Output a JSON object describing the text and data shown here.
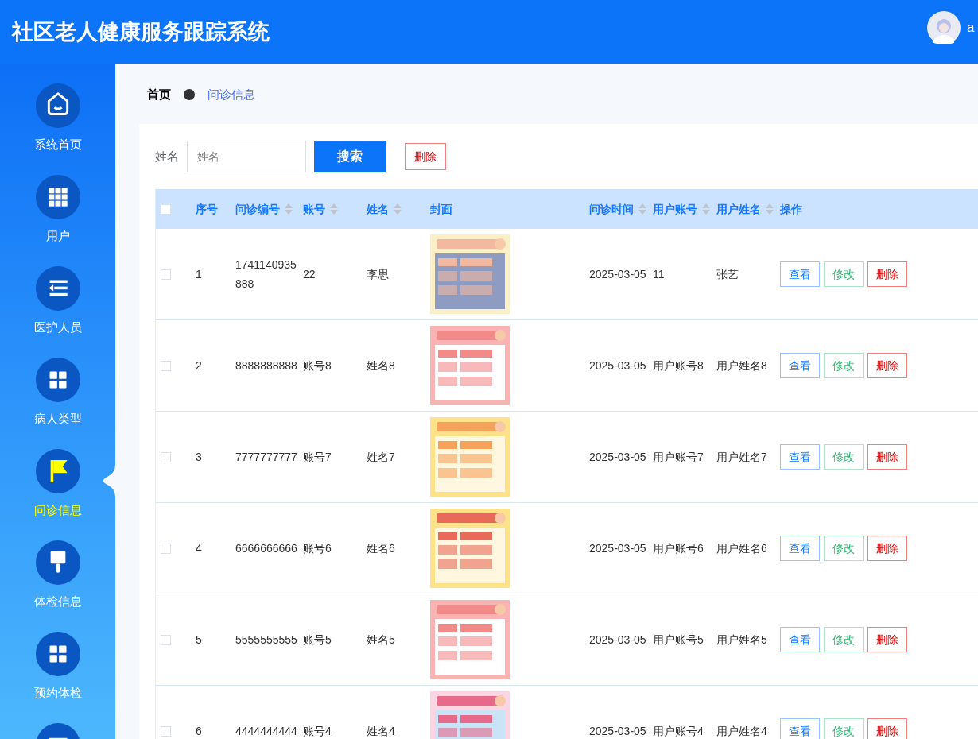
{
  "header": {
    "title": "社区老人健康服务跟踪系统",
    "user": "a"
  },
  "sidebar": {
    "items": [
      {
        "label": "系统首页",
        "kind": "home",
        "selected": false
      },
      {
        "label": "用户",
        "kind": "grid9",
        "selected": false
      },
      {
        "label": "医护人员",
        "kind": "list",
        "selected": false
      },
      {
        "label": "病人类型",
        "kind": "grid4",
        "selected": false
      },
      {
        "label": "问诊信息",
        "kind": "flag",
        "selected": true
      },
      {
        "label": "体检信息",
        "kind": "brush",
        "selected": false
      },
      {
        "label": "预约体检",
        "kind": "grid4",
        "selected": false
      },
      {
        "kind": "card",
        "selected": false
      }
    ]
  },
  "breadcrumb": [
    "首页",
    "问诊信息"
  ],
  "search": {
    "label": "姓名",
    "placeholder": "姓名",
    "search_button": "搜索",
    "delete_button": "删除"
  },
  "table": {
    "select_all": false,
    "columns": [
      {
        "label": "序号",
        "sortable": false
      },
      {
        "label": "问诊编号",
        "sortable": true
      },
      {
        "label": "账号",
        "sortable": true
      },
      {
        "label": "姓名",
        "sortable": true
      },
      {
        "label": "封面",
        "sortable": false
      },
      {
        "label": "问诊时间",
        "sortable": true
      },
      {
        "label": "用户账号",
        "sortable": true
      },
      {
        "label": "用户姓名",
        "sortable": true
      },
      {
        "label": "操作",
        "sortable": false
      }
    ],
    "rows": [
      {
        "checked": false,
        "index": "1",
        "number": "1741140935888",
        "account": "22",
        "name": "李思",
        "time": "2025-03-05",
        "user_account": "11",
        "user_name": "张艺",
        "actions": [
          "查看",
          "修改",
          "删除"
        ]
      },
      {
        "checked": false,
        "index": "2",
        "number": "8888888888",
        "account": "账号8",
        "name": "姓名8",
        "time": "2025-03-05",
        "user_account": "用户账号8",
        "user_name": "用户姓名8",
        "actions": [
          "查看",
          "修改",
          "删除"
        ]
      },
      {
        "checked": false,
        "index": "3",
        "number": "7777777777",
        "account": "账号7",
        "name": "姓名7",
        "time": "2025-03-05",
        "user_account": "用户账号7",
        "user_name": "用户姓名7",
        "actions": [
          "查看",
          "修改",
          "删除"
        ]
      },
      {
        "checked": false,
        "index": "4",
        "number": "6666666666",
        "account": "账号6",
        "name": "姓名6",
        "time": "2025-03-05",
        "user_account": "用户账号6",
        "user_name": "用户姓名6",
        "actions": [
          "查看",
          "修改",
          "删除"
        ]
      },
      {
        "checked": false,
        "index": "5",
        "number": "5555555555",
        "account": "账号5",
        "name": "姓名5",
        "time": "2025-03-05",
        "user_account": "用户账号5",
        "user_name": "用户姓名5",
        "actions": [
          "查看",
          "修改",
          "删除"
        ]
      },
      {
        "checked": false,
        "index": "6",
        "number": "4444444444",
        "account": "账号4",
        "name": "姓名4",
        "time": "2025-03-05",
        "user_account": "用户账号4",
        "user_name": "用户姓名4",
        "actions": [
          "查看",
          "修改",
          "删除"
        ]
      }
    ]
  }
}
